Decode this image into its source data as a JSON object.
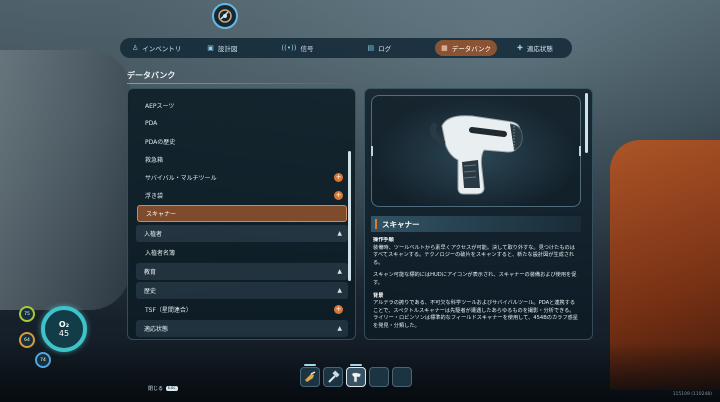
{
  "tabs": [
    {
      "label": "インベントリ",
      "icon": "person-icon",
      "active": false
    },
    {
      "label": "設計図",
      "icon": "blueprint-icon",
      "active": false
    },
    {
      "label": "信号",
      "icon": "signal-icon",
      "active": false
    },
    {
      "label": "ログ",
      "icon": "log-icon",
      "active": false
    },
    {
      "label": "データバンク",
      "icon": "databank-icon",
      "active": true
    },
    {
      "label": "適応状態",
      "icon": "adaptation-icon",
      "active": false
    }
  ],
  "section_title": "データバンク",
  "list": {
    "items": [
      {
        "label": "AEPスーツ",
        "kind": "item",
        "new": false
      },
      {
        "label": "PDA",
        "kind": "item",
        "new": false
      },
      {
        "label": "PDAの歴史",
        "kind": "item",
        "new": false
      },
      {
        "label": "救急箱",
        "kind": "item",
        "new": false
      },
      {
        "label": "サバイバル・マルチツール",
        "kind": "item",
        "new": true
      },
      {
        "label": "浮き袋",
        "kind": "item",
        "new": true
      },
      {
        "label": "スキャナー",
        "kind": "item",
        "new": false,
        "selected": true
      },
      {
        "label": "入植者",
        "kind": "header"
      },
      {
        "label": "入植者名簿",
        "kind": "item",
        "new": false
      },
      {
        "label": "教育",
        "kind": "header"
      },
      {
        "label": "歴史",
        "kind": "header"
      },
      {
        "label": "TSF（星間連合）",
        "kind": "item",
        "new": true
      },
      {
        "label": "適応状態",
        "kind": "header"
      }
    ]
  },
  "detail": {
    "title": "スキャナー",
    "usage_heading": "操作手順",
    "usage_text": "装備時、ツールベルトから素早くアクセスが可能。決して取り外すな。見つけたものはすべてスキャンする。テクノロジーの破片をスキャンすると、新たな設計図が生成される。",
    "hud_text": "スキャン可能な標的にはHUDにアイコンが表示され、スキャナーの装備および使用を促す。",
    "background_heading": "背景",
    "background_text": "アルテラの誇りである、不可欠な科学ツールおよびサバイバルツール。PDAと連携することで、スペクトルスキャナーは先駆者が遭遇したあらゆるものを撮影・分析できる。ライリー・ロビンソンは標準的なフィールドスキャナーを使用して、454Bのカラフ惑星を発見・分類した。"
  },
  "vitals": {
    "o2_label": "O₂",
    "o2_value": "45",
    "food": "75",
    "water": "64",
    "health": "74"
  },
  "close_hint": {
    "label": "閉じる",
    "key": "Esc"
  },
  "quickbar": [
    {
      "icon": "multitool-icon",
      "active": false
    },
    {
      "icon": "hammer-icon",
      "active": false
    },
    {
      "icon": "scanner-icon",
      "active": true
    },
    {
      "icon": "empty-slot",
      "active": false
    },
    {
      "icon": "empty-slot",
      "active": false
    }
  ],
  "version": "115109 (110248)",
  "colors": {
    "accent": "#8a5434",
    "highlight": "#e07a2e",
    "o2": "#3fc2c8"
  }
}
